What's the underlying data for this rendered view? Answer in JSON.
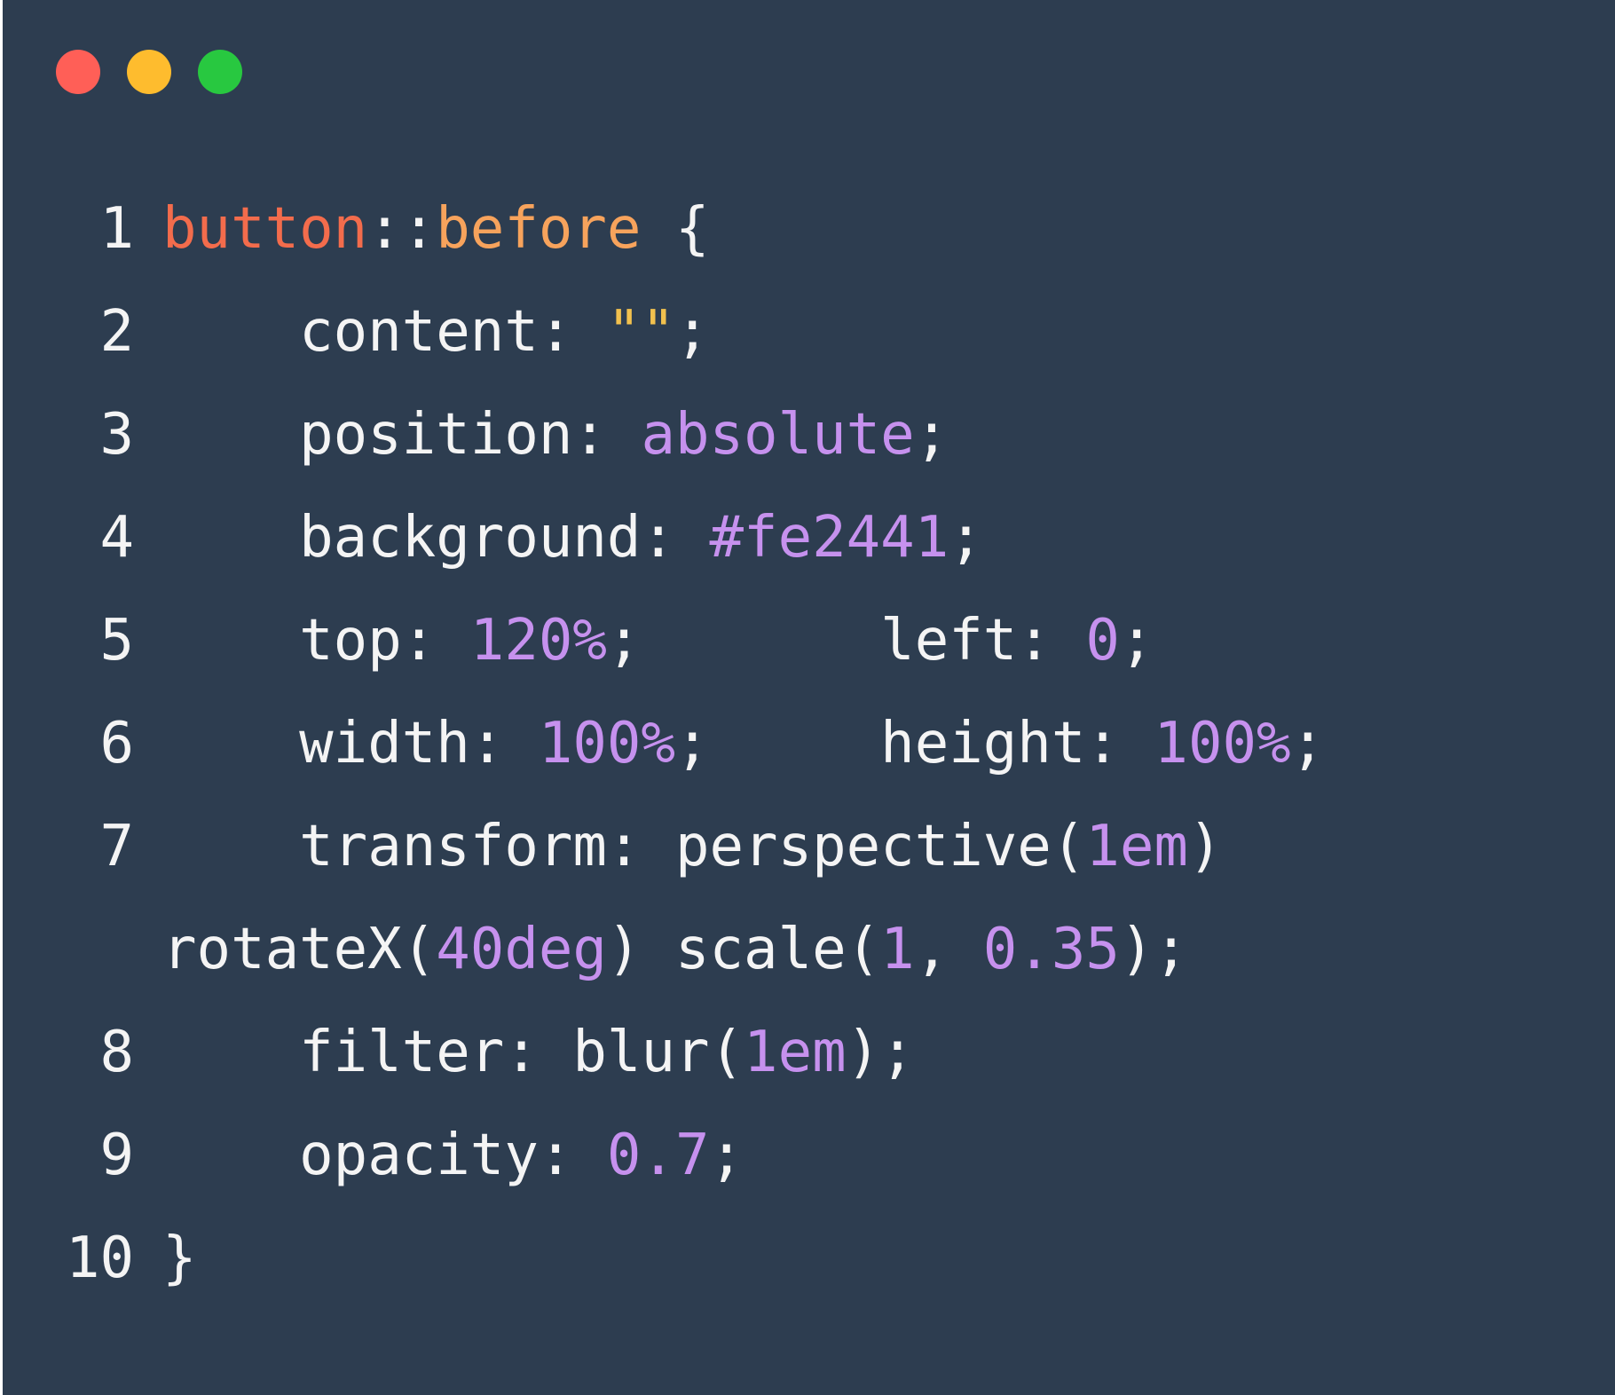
{
  "window": {
    "controls": [
      {
        "name": "close",
        "color": "#ff5f57"
      },
      {
        "name": "minimize",
        "color": "#febc2e"
      },
      {
        "name": "maximize",
        "color": "#28c840"
      }
    ]
  },
  "colors": {
    "background": "#2d3d50",
    "text": "#f4f4f4",
    "selector": "#f36c4c",
    "pseudo": "#f7a35c",
    "string": "#f2c14e",
    "value": "#c691ee"
  },
  "code": {
    "lines": [
      {
        "number": "1",
        "indent": "",
        "tokens": [
          {
            "t": "button",
            "k": "selector"
          },
          {
            "t": "::",
            "k": "plain"
          },
          {
            "t": "before",
            "k": "pseudo"
          },
          {
            "t": " {",
            "k": "plain"
          }
        ]
      },
      {
        "number": "2",
        "indent": "    ",
        "tokens": [
          {
            "t": "content: ",
            "k": "plain"
          },
          {
            "t": "\"\"",
            "k": "string"
          },
          {
            "t": ";",
            "k": "plain"
          }
        ]
      },
      {
        "number": "3",
        "indent": "    ",
        "tokens": [
          {
            "t": "position: ",
            "k": "plain"
          },
          {
            "t": "absolute",
            "k": "value"
          },
          {
            "t": ";",
            "k": "plain"
          }
        ]
      },
      {
        "number": "4",
        "indent": "    ",
        "tokens": [
          {
            "t": "background: ",
            "k": "plain"
          },
          {
            "t": "#fe2441",
            "k": "value"
          },
          {
            "t": ";",
            "k": "plain"
          }
        ]
      },
      {
        "number": "5",
        "indent": "    ",
        "tokens": [
          {
            "t": "top: ",
            "k": "plain"
          },
          {
            "t": "120%",
            "k": "value"
          },
          {
            "t": ";       left: ",
            "k": "plain"
          },
          {
            "t": "0",
            "k": "value"
          },
          {
            "t": ";",
            "k": "plain"
          }
        ]
      },
      {
        "number": "6",
        "indent": "    ",
        "tokens": [
          {
            "t": "width: ",
            "k": "plain"
          },
          {
            "t": "100%",
            "k": "value"
          },
          {
            "t": ";     height: ",
            "k": "plain"
          },
          {
            "t": "100%",
            "k": "value"
          },
          {
            "t": ";",
            "k": "plain"
          }
        ]
      },
      {
        "number": "7",
        "indent": "    ",
        "tokens": [
          {
            "t": "transform: perspective(",
            "k": "plain"
          },
          {
            "t": "1em",
            "k": "value"
          },
          {
            "t": ")",
            "k": "plain"
          }
        ]
      },
      {
        "number": "",
        "indent": "",
        "tokens": [
          {
            "t": "rotateX(",
            "k": "plain"
          },
          {
            "t": "40deg",
            "k": "value"
          },
          {
            "t": ") scale(",
            "k": "plain"
          },
          {
            "t": "1",
            "k": "value"
          },
          {
            "t": ", ",
            "k": "plain"
          },
          {
            "t": "0.35",
            "k": "value"
          },
          {
            "t": ");",
            "k": "plain"
          }
        ]
      },
      {
        "number": "8",
        "indent": "    ",
        "tokens": [
          {
            "t": "filter: blur(",
            "k": "plain"
          },
          {
            "t": "1em",
            "k": "value"
          },
          {
            "t": ");",
            "k": "plain"
          }
        ]
      },
      {
        "number": "9",
        "indent": "    ",
        "tokens": [
          {
            "t": "opacity: ",
            "k": "plain"
          },
          {
            "t": "0.7",
            "k": "value"
          },
          {
            "t": ";",
            "k": "plain"
          }
        ]
      },
      {
        "number": "10",
        "indent": "",
        "tokens": [
          {
            "t": "}",
            "k": "plain"
          }
        ]
      }
    ]
  }
}
